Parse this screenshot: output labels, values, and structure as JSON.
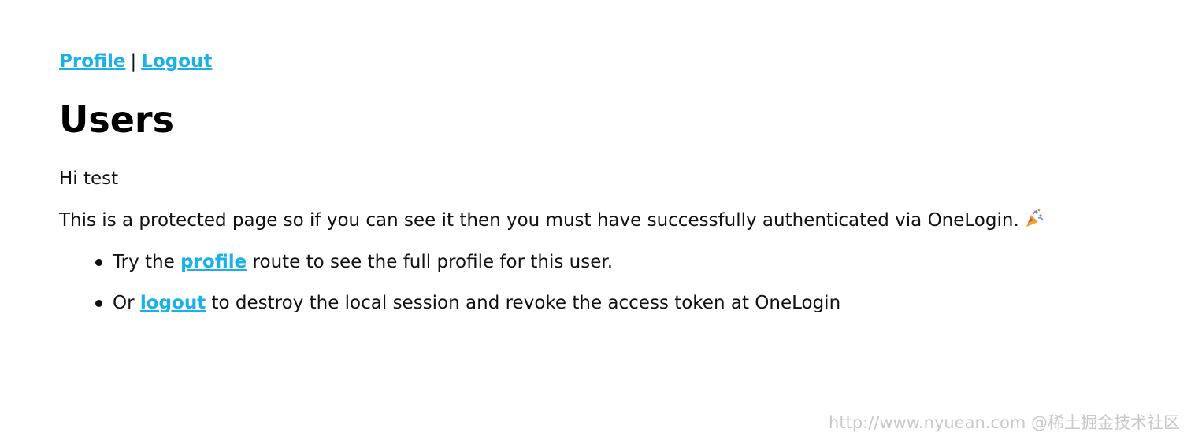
{
  "nav": {
    "profile_label": "Profile",
    "separator": "|",
    "logout_label": "Logout"
  },
  "page": {
    "title": "Users",
    "greeting": "Hi test",
    "description": "This is a protected page so if you can see it then you must have successfully authenticated via OneLogin.",
    "celebration_icon": "party-popper-icon"
  },
  "list": {
    "item1": {
      "prefix": "Try the ",
      "link": "profile",
      "suffix": " route to see the full profile for this user."
    },
    "item2": {
      "prefix": "Or ",
      "link": "logout",
      "suffix": " to destroy the local session and revoke the access token at OneLogin"
    }
  },
  "watermark": "http://www.nyuean.com @稀土掘金技术社区",
  "colors": {
    "link": "#1ab0e8",
    "text": "#111111",
    "background": "#ffffff"
  }
}
